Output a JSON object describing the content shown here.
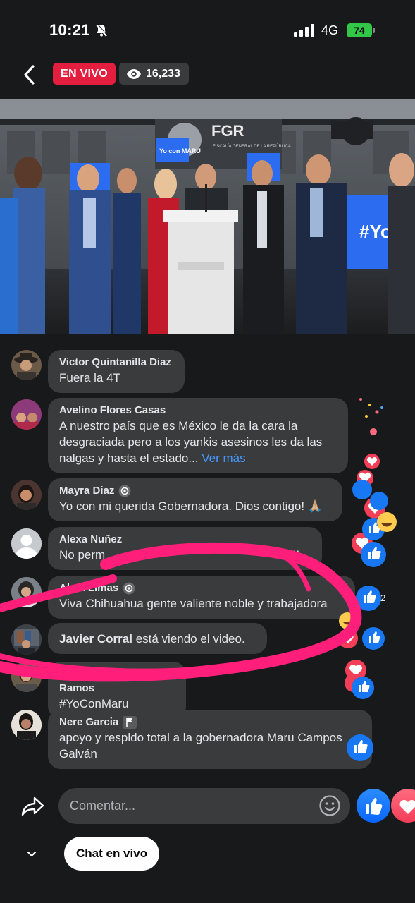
{
  "status": {
    "time": "10:21",
    "network": "4G",
    "battery": "74"
  },
  "header": {
    "live_label": "EN VIVO",
    "viewer_count": "16,233"
  },
  "comments": [
    {
      "author": "Victor Quintanilla Diaz",
      "text": "Fuera la 4T"
    },
    {
      "author": "Avelino Flores Casas",
      "text": "A nuestro país que es México le da la cara la desgraciada pero a los yankis asesinos les da las nalgas y hasta el estado...",
      "see_more": "Ver más"
    },
    {
      "author": "Mayra Diaz",
      "text": "Yo con mi querida Gobernadora. Dios contigo! 🙏🏼"
    },
    {
      "author": "Alexa Nuñez",
      "text": "No perm",
      "text_tail": "aru!!"
    },
    {
      "author": "Alma Limas",
      "text": "Viva Chihuahua gente valiente noble y trabajadora"
    },
    {
      "author": "Javier Corral",
      "text": "está viendo el video."
    },
    {
      "author": "Verónica Baeza Ramos",
      "text": "#YoConMaru"
    },
    {
      "author": "Nere Garcia",
      "text": "apoyo y respldo total a la gobernadora Maru Campos Galván"
    }
  ],
  "reaction_count": "2",
  "composer": {
    "placeholder": "Comentar..."
  },
  "footer": {
    "chat_label": "Chat en vivo"
  },
  "video": {
    "sign_fgr": "FGR",
    "sign_sub": "FISCALÍA GENERAL DE LA REPÚBLICA",
    "placard": "Yo con MARU"
  },
  "colors": {
    "live_red": "#e41e3f",
    "like_blue": "#0866ff",
    "love_red": "#f33e58",
    "scribble_pink": "#ff1f7a"
  }
}
